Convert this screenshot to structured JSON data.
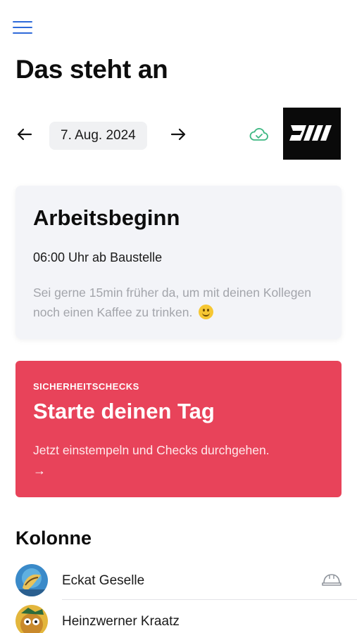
{
  "header": {
    "menu_icon": "hamburger-menu-icon",
    "title": "Das steht an"
  },
  "date_nav": {
    "prev_icon": "arrow-left-icon",
    "date": "7. Aug. 2024",
    "next_icon": "arrow-right-icon",
    "sync_icon": "cloud-check-icon",
    "sync_color": "#3fb883"
  },
  "logo": {
    "text": "DW"
  },
  "start_card": {
    "title": "Arbeitsbeginn",
    "time": "06:00 Uhr ab Baustelle",
    "note": "Sei gerne 15min früher da, um mit deinen Kollegen noch einen Kaffee zu trinken."
  },
  "cta_card": {
    "eyebrow": "SICHERHEITSCHECKS",
    "title": "Starte deinen Tag",
    "subtitle": "Jetzt einstempeln und Checks durchgehen.",
    "arrow": "→",
    "color": "#e8435a"
  },
  "team": {
    "title": "Kolonne",
    "members": [
      {
        "name": "Eckat Geselle",
        "icon": "helmet-icon"
      },
      {
        "name": "Heinzwerner Kraatz"
      }
    ]
  }
}
